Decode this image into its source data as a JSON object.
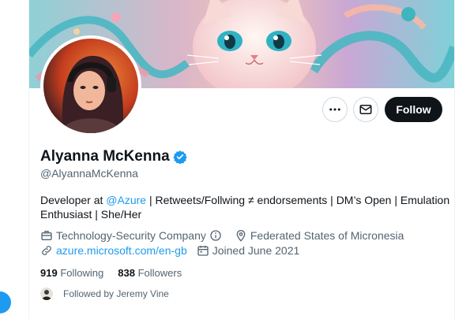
{
  "profile": {
    "name": "Alyanna McKenna",
    "handle": "@AlyannaMcKenna",
    "verified": true
  },
  "actions": {
    "more_icon": "more-horizontal-icon",
    "message_icon": "mail-icon",
    "follow_label": "Follow"
  },
  "bio": {
    "prefix": "Developer at ",
    "mention": "@Azure",
    "suffix": " | Retweets/Follwing ≠ endorsements | DM’s Open | Emulation Enthusiast | She/Her"
  },
  "meta": {
    "category": "Technology-Security Company",
    "location": "Federated States of Micronesia",
    "website": "azure.microsoft.com/en-gb",
    "joined": "Joined June 2021"
  },
  "stats": {
    "following_count": "919",
    "following_label": "Following",
    "followers_count": "838",
    "followers_label": "Followers"
  },
  "followed_by": "Followed by Jeremy Vine",
  "colors": {
    "accent": "#1d9bf0",
    "text_primary": "#0f1419",
    "text_secondary": "#536471",
    "button_dark": "#0f1419",
    "border": "#cfd9de"
  }
}
